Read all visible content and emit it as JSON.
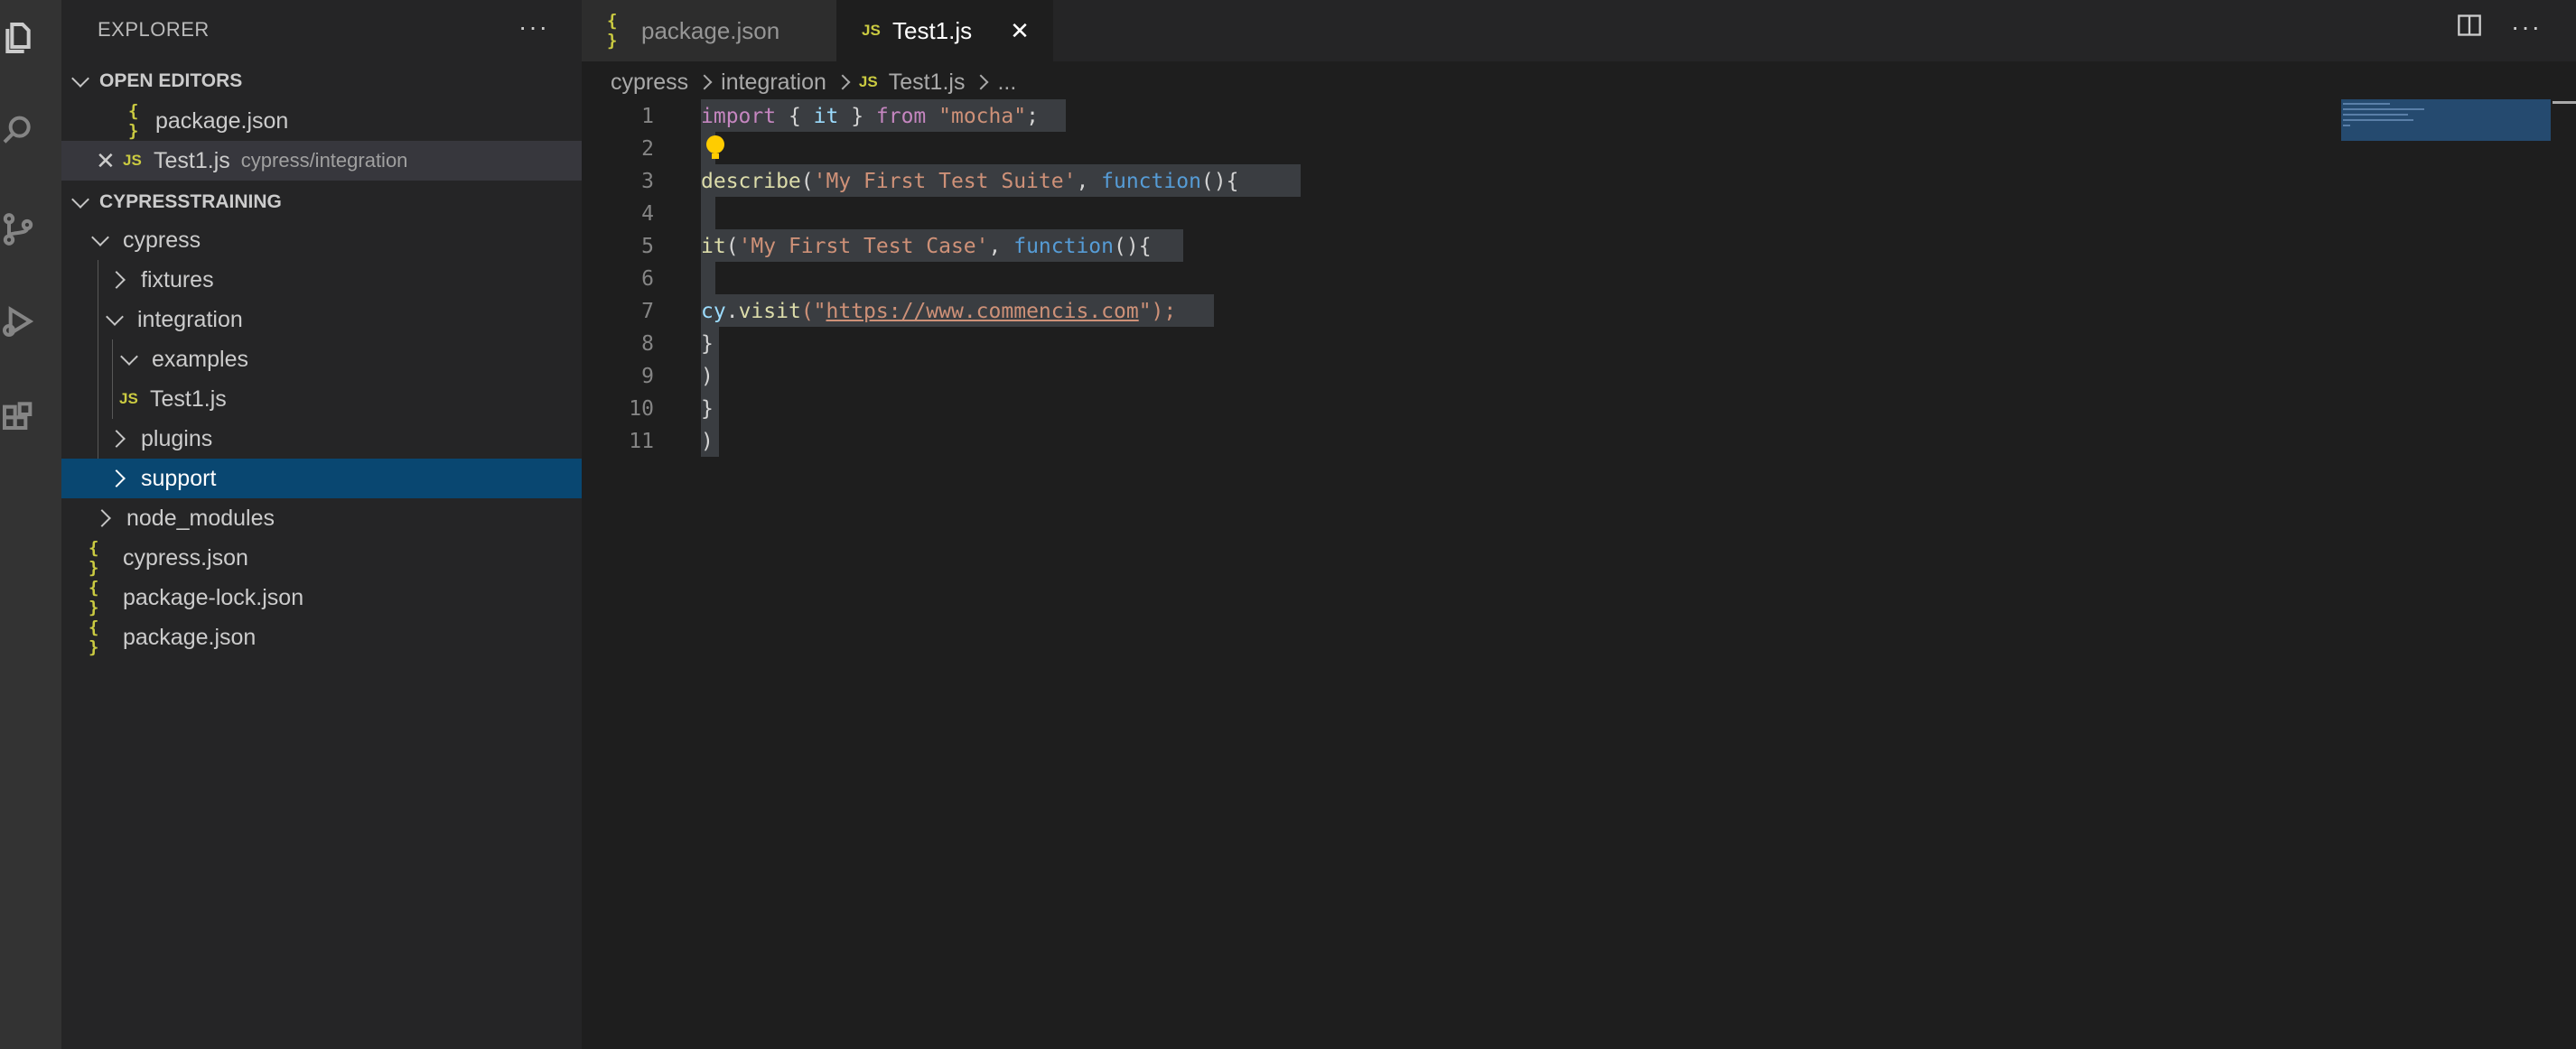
{
  "explorer": {
    "title": "EXPLORER",
    "more": "···"
  },
  "open_editors": {
    "title": "OPEN EDITORS",
    "items": [
      {
        "icon": "{ }",
        "name": "package.json",
        "desc": ""
      },
      {
        "icon": "JS",
        "name": "Test1.js",
        "desc": "cypress/integration"
      }
    ]
  },
  "project": {
    "title": "CYPRESSTRAINING",
    "tree": [
      {
        "label": "cypress"
      },
      {
        "label": "fixtures"
      },
      {
        "label": "integration"
      },
      {
        "label": "examples"
      },
      {
        "label": "Test1.js",
        "icon": "JS"
      },
      {
        "label": "plugins"
      },
      {
        "label": "support"
      },
      {
        "label": "node_modules"
      },
      {
        "label": "cypress.json",
        "icon": "{ }"
      },
      {
        "label": "package-lock.json",
        "icon": "{ }"
      },
      {
        "label": "package.json",
        "icon": "{ }"
      }
    ]
  },
  "tabs": [
    {
      "icon": "{ }",
      "label": "package.json"
    },
    {
      "icon": "JS",
      "label": "Test1.js",
      "close": "✕"
    }
  ],
  "breadcrumb": {
    "parts": [
      "cypress",
      "integration",
      "Test1.js",
      "..."
    ],
    "icon": "JS"
  },
  "editor": {
    "line_numbers": [
      "1",
      "2",
      "3",
      "4",
      "5",
      "6",
      "7",
      "8",
      "9",
      "10",
      "11"
    ],
    "lines": {
      "l1": {
        "a": "import",
        "b": " { ",
        "c": "it",
        "d": " } ",
        "e": "from",
        "f": " ",
        "g": "\"mocha\"",
        "h": ";"
      },
      "l3": {
        "a": "describe",
        "b": "(",
        "c": "'My First Test Suite'",
        "d": ", ",
        "e": "function",
        "f": "(){"
      },
      "l5": {
        "a": "it",
        "b": "(",
        "c": "'My First Test Case'",
        "d": ", ",
        "e": "function",
        "f": "(){"
      },
      "l7": {
        "a": "cy",
        "b": ".",
        "c": "visit",
        "d": "(\"",
        "e": "https://www.commencis.com",
        "f": "\");"
      },
      "l8": "}",
      "l9": ")",
      "l10": "}",
      "l11": ")"
    }
  },
  "colors": {
    "selection": "#094771",
    "accent_yellow": "#cbcb41"
  }
}
